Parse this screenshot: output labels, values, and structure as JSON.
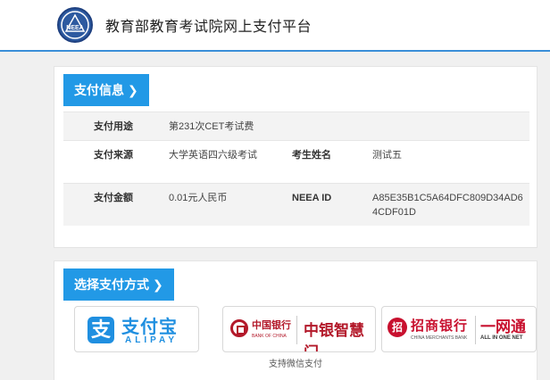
{
  "header": {
    "logo_icon": "neea-logo-icon",
    "logo_text": "NEEA",
    "title": "教育部教育考试院网上支付平台"
  },
  "payment_info": {
    "section_title": "支付信息",
    "chevron": "❯",
    "purpose_label": "支付用途",
    "purpose_value": "第231次CET考试费",
    "source_label": "支付来源",
    "source_value": "大学英语四六级考试",
    "name_label": "考生姓名",
    "name_value": "测试五",
    "amount_label": "支付金额",
    "amount_value": "0.01元人民币",
    "neea_label": "NEEA ID",
    "neea_value": "A85E35B1C5A64DFC809D34AD64CDF01D"
  },
  "payment_method": {
    "section_title": "选择支付方式",
    "chevron": "❯",
    "alipay": {
      "mark": "支",
      "cn": "支付宝",
      "en": "ALIPAY"
    },
    "boc": {
      "cn": "中国银行",
      "en": "BANK OF CHINA",
      "brand": "中银智慧门"
    },
    "cmb": {
      "mark": "招",
      "cn": "招商银行",
      "en": "CHINA MERCHANTS BANK",
      "brand": "一网通",
      "brand_en": "ALL IN ONE NET"
    },
    "caption": "支持微信支付"
  },
  "colors": {
    "accent": "#2299e6",
    "header_border": "#3a8fd8",
    "alipay": "#1f8fe0",
    "bank_red": "#b3192a"
  }
}
